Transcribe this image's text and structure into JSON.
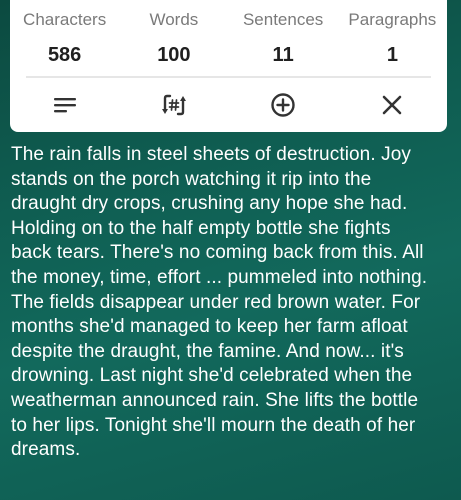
{
  "stats": [
    {
      "label": "Characters",
      "value": "586"
    },
    {
      "label": "Words",
      "value": "100"
    },
    {
      "label": "Sentences",
      "value": "11"
    },
    {
      "label": "Paragraphs",
      "value": "1"
    }
  ],
  "toolbar": {
    "icons": [
      "menu-lines-icon",
      "hashtag-refresh-icon",
      "add-circle-icon",
      "close-icon"
    ]
  },
  "text": {
    "lines": [
      "The rain falls in steel sheets of destruction. Joy",
      "stands on the porch watching it rip into the",
      "draught dry crops, crushing any hope she had.",
      "Holding on to the half empty bottle she fights",
      "back tears. There's no coming back from this. All",
      "the money, time, effort ... pummeled into nothing.",
      "The fields disappear under red brown water. For",
      "months she'd managed to keep her farm afloat",
      "despite the draught, the famine. And now... it's",
      "drowning. Last night she'd celebrated when the",
      "weatherman announced rain. She lifts the bottle",
      "to her lips. Tonight she'll mourn the death of her",
      "dreams."
    ]
  },
  "colors": {
    "background": "#0f5e52",
    "card": "#ffffff",
    "label": "#7a7a7a",
    "value": "#202020",
    "icon": "#333333"
  }
}
